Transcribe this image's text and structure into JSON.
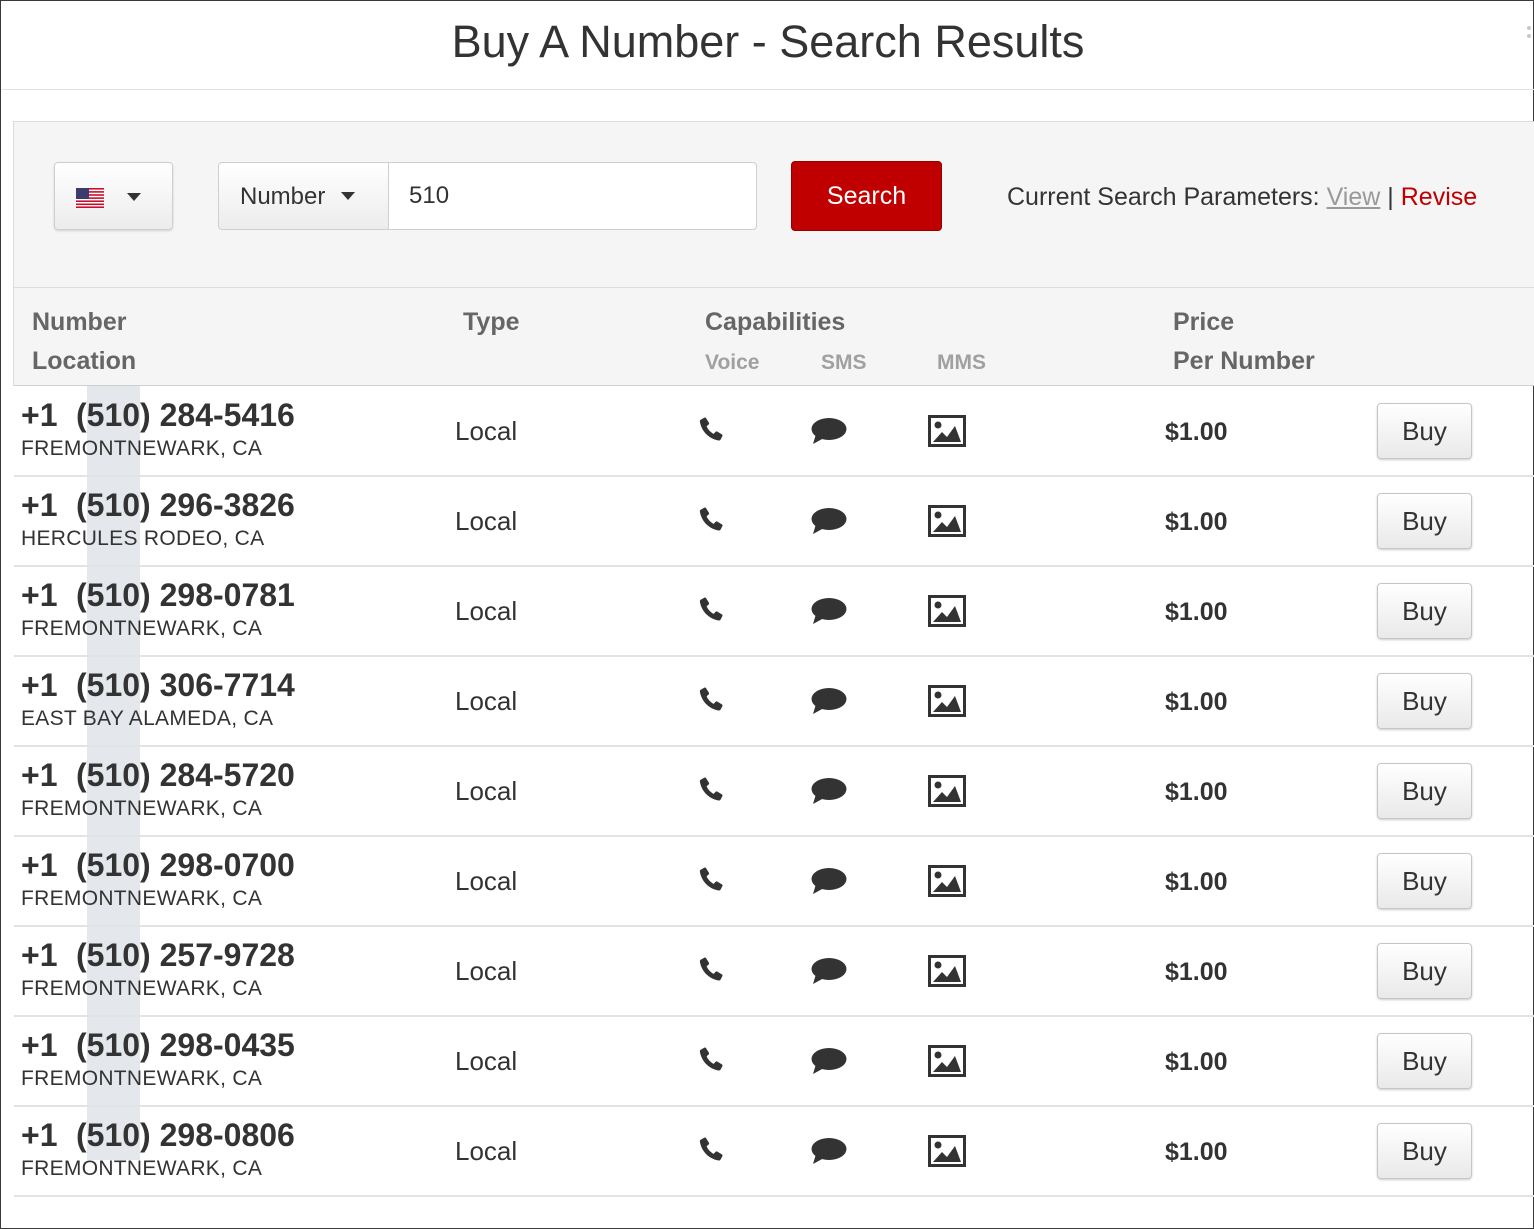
{
  "window": {
    "title": "Buy A Number - Search Results"
  },
  "search": {
    "country_icon": "us-flag-icon",
    "type_select": "Number",
    "query": "510",
    "search_label": "Search",
    "params_label": "Current Search Parameters:",
    "view_label": "View",
    "separator": "|",
    "revise_label": "Revise"
  },
  "table": {
    "headers": {
      "number": "Number",
      "location": "Location",
      "type": "Type",
      "capabilities": "Capabilities",
      "voice": "Voice",
      "sms": "SMS",
      "mms": "MMS",
      "price": "Price",
      "per_number": "Per Number"
    },
    "buy_label": "Buy",
    "icons": {
      "voice": "phone-icon",
      "sms": "chat-bubble-icon",
      "mms": "picture-icon"
    },
    "rows": [
      {
        "country_code": "+1",
        "number": "(510) 284-5416",
        "location": "FREMONTNEWARK, CA",
        "type": "Local",
        "price": "$1.00"
      },
      {
        "country_code": "+1",
        "number": "(510) 296-3826",
        "location": "HERCULES RODEO, CA",
        "type": "Local",
        "price": "$1.00"
      },
      {
        "country_code": "+1",
        "number": "(510) 298-0781",
        "location": "FREMONTNEWARK, CA",
        "type": "Local",
        "price": "$1.00"
      },
      {
        "country_code": "+1",
        "number": "(510) 306-7714",
        "location": "EAST BAY ALAMEDA, CA",
        "type": "Local",
        "price": "$1.00"
      },
      {
        "country_code": "+1",
        "number": "(510) 284-5720",
        "location": "FREMONTNEWARK, CA",
        "type": "Local",
        "price": "$1.00"
      },
      {
        "country_code": "+1",
        "number": "(510) 298-0700",
        "location": "FREMONTNEWARK, CA",
        "type": "Local",
        "price": "$1.00"
      },
      {
        "country_code": "+1",
        "number": "(510) 257-9728",
        "location": "FREMONTNEWARK, CA",
        "type": "Local",
        "price": "$1.00"
      },
      {
        "country_code": "+1",
        "number": "(510) 298-0435",
        "location": "FREMONTNEWARK, CA",
        "type": "Local",
        "price": "$1.00"
      },
      {
        "country_code": "+1",
        "number": "(510) 298-0806",
        "location": "FREMONTNEWARK, CA",
        "type": "Local",
        "price": "$1.00"
      }
    ]
  }
}
